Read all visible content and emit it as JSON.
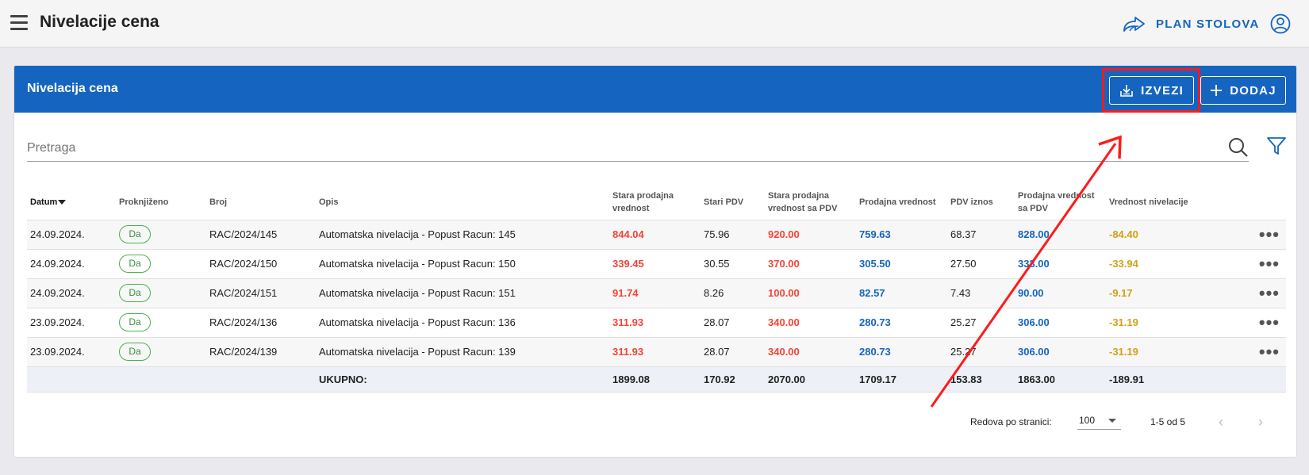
{
  "topbar": {
    "title": "Nivelacije cena",
    "plan_label": "PLAN STOLOVA"
  },
  "card": {
    "title": "Nivelacija cena",
    "export_label": "IZVEZI",
    "add_label": "DODAJ"
  },
  "search": {
    "placeholder": "Pretraga"
  },
  "table": {
    "headers": {
      "datum": "Datum",
      "proknjizeno": "Proknjiženo",
      "broj": "Broj",
      "opis": "Opis",
      "stara_prodajna": "Stara prodajna vrednost",
      "stari_pdv": "Stari PDV",
      "stara_sa_pdv": "Stara prodajna vrednost sa PDV",
      "prodajna": "Prodajna vrednost",
      "pdv_iznos": "PDV iznos",
      "prodajna_sa_pdv": "Prodajna vrednost sa PDV",
      "vrednost_nivelacije": "Vrednost nivelacije"
    },
    "rows": [
      {
        "datum": "24.09.2024.",
        "proknjizeno": "Da",
        "broj": "RAC/2024/145",
        "opis": "Automatska nivelacija - Popust Racun: 145",
        "stara_prodajna": "844.04",
        "stari_pdv": "75.96",
        "stara_sa_pdv": "920.00",
        "prodajna": "759.63",
        "pdv_iznos": "68.37",
        "prodajna_sa_pdv": "828.00",
        "vrednost_nivelacije": "-84.40"
      },
      {
        "datum": "24.09.2024.",
        "proknjizeno": "Da",
        "broj": "RAC/2024/150",
        "opis": "Automatska nivelacija - Popust Racun: 150",
        "stara_prodajna": "339.45",
        "stari_pdv": "30.55",
        "stara_sa_pdv": "370.00",
        "prodajna": "305.50",
        "pdv_iznos": "27.50",
        "prodajna_sa_pdv": "333.00",
        "vrednost_nivelacije": "-33.94"
      },
      {
        "datum": "24.09.2024.",
        "proknjizeno": "Da",
        "broj": "RAC/2024/151",
        "opis": "Automatska nivelacija - Popust Racun: 151",
        "stara_prodajna": "91.74",
        "stari_pdv": "8.26",
        "stara_sa_pdv": "100.00",
        "prodajna": "82.57",
        "pdv_iznos": "7.43",
        "prodajna_sa_pdv": "90.00",
        "vrednost_nivelacije": "-9.17"
      },
      {
        "datum": "23.09.2024.",
        "proknjizeno": "Da",
        "broj": "RAC/2024/136",
        "opis": "Automatska nivelacija - Popust Racun: 136",
        "stara_prodajna": "311.93",
        "stari_pdv": "28.07",
        "stara_sa_pdv": "340.00",
        "prodajna": "280.73",
        "pdv_iznos": "25.27",
        "prodajna_sa_pdv": "306.00",
        "vrednost_nivelacije": "-31.19"
      },
      {
        "datum": "23.09.2024.",
        "proknjizeno": "Da",
        "broj": "RAC/2024/139",
        "opis": "Automatska nivelacija - Popust Racun: 139",
        "stara_prodajna": "311.93",
        "stari_pdv": "28.07",
        "stara_sa_pdv": "340.00",
        "prodajna": "280.73",
        "pdv_iznos": "25.27",
        "prodajna_sa_pdv": "306.00",
        "vrednost_nivelacije": "-31.19"
      }
    ],
    "totals": {
      "label": "UKUPNO:",
      "stara_prodajna": "1899.08",
      "stari_pdv": "170.92",
      "stara_sa_pdv": "2070.00",
      "prodajna": "1709.17",
      "pdv_iznos": "153.83",
      "prodajna_sa_pdv": "1863.00",
      "vrednost_nivelacije": "-189.91"
    },
    "row_menu_glyph": "•••"
  },
  "pagination": {
    "rows_per_page_label": "Redova po stranici:",
    "rows_per_page": "100",
    "range": "1-5 od 5",
    "prev_glyph": "‹",
    "next_glyph": "›"
  },
  "colors": {
    "primary": "#1565c0",
    "old_value": "#f44336",
    "new_value": "#1565c0",
    "difference": "#d4a017",
    "annotation": "#ff1a1a",
    "badge": "#4caf50"
  },
  "icons": {
    "menu": "menu-icon",
    "plan": "forward-arrow-icon",
    "user": "user-circle-icon",
    "export": "download-icon",
    "add": "plus-icon",
    "search": "search-icon",
    "filter": "filter-icon",
    "row_menu": "more-horizontal-icon"
  }
}
